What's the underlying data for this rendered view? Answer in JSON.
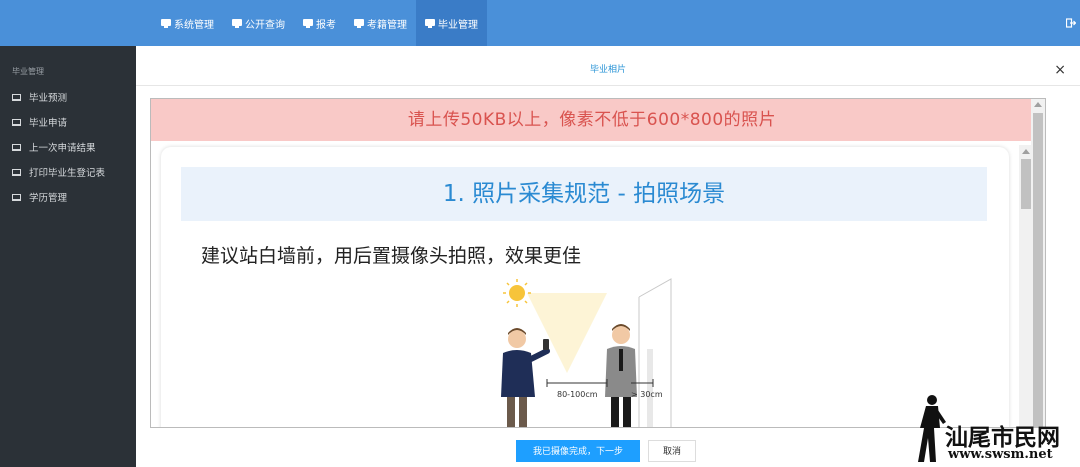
{
  "nav": {
    "items": [
      {
        "label": "系统管理"
      },
      {
        "label": "公开查询"
      },
      {
        "label": "报考"
      },
      {
        "label": "考籍管理"
      },
      {
        "label": "毕业管理"
      }
    ],
    "active_index": 4
  },
  "sidebar": {
    "heading": "毕业管理",
    "items": [
      {
        "label": "毕业预测"
      },
      {
        "label": "毕业申请"
      },
      {
        "label": "上一次申请结果"
      },
      {
        "label": "打印毕业生登记表"
      },
      {
        "label": "学历管理"
      }
    ]
  },
  "modal": {
    "title": "毕业相片",
    "close": "×",
    "banner": "请上传50KB以上，像素不低于600*800的照片",
    "section_title": "1. 照片采集规范 - 拍照场景",
    "hint": "建议站白墙前，用后置摄像头拍照，效果更佳",
    "scene": {
      "distance_person": "80-100cm",
      "distance_wall": "> 30cm"
    },
    "confirm_label": "我已摄像完成，下一步",
    "cancel_label": "取消"
  },
  "watermark": {
    "text": "汕尾市民网",
    "url": "www.swsm.net"
  },
  "colors": {
    "topbar": "#4a90d9",
    "sidebar": "#2b3137",
    "banner_bg": "#f9c9c7",
    "banner_text": "#d9534f",
    "primary": "#1e9fff"
  }
}
